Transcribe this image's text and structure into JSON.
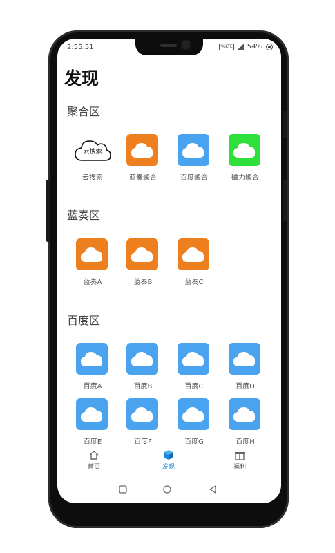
{
  "status": {
    "time": "2:55:51",
    "network_badge": "VoLTE",
    "battery": "54%"
  },
  "page": {
    "title": "发现"
  },
  "sections": [
    {
      "title": "聚合区",
      "items": [
        {
          "label": "云搜索",
          "color": "outline",
          "icon_text": "云搜索"
        },
        {
          "label": "蓝奏聚合",
          "color": "#ee7f1f"
        },
        {
          "label": "百度聚合",
          "color": "#4aa3ef"
        },
        {
          "label": "磁力聚合",
          "color": "#2fe03a"
        }
      ]
    },
    {
      "title": "蓝奏区",
      "items": [
        {
          "label": "蓝奏A",
          "color": "#ee7f1f"
        },
        {
          "label": "蓝奏B",
          "color": "#ee7f1f"
        },
        {
          "label": "蓝奏C",
          "color": "#ee7f1f"
        }
      ]
    },
    {
      "title": "百度区",
      "items": [
        {
          "label": "百度A",
          "color": "#4aa3ef"
        },
        {
          "label": "百度B",
          "color": "#4aa3ef"
        },
        {
          "label": "百度C",
          "color": "#4aa3ef"
        },
        {
          "label": "百度D",
          "color": "#4aa3ef"
        },
        {
          "label": "百度E",
          "color": "#4aa3ef"
        },
        {
          "label": "百度F",
          "color": "#4aa3ef"
        },
        {
          "label": "百度G",
          "color": "#4aa3ef"
        },
        {
          "label": "百度H",
          "color": "#4aa3ef"
        }
      ]
    }
  ],
  "tabs": [
    {
      "label": "首页",
      "icon": "home-icon",
      "active": false
    },
    {
      "label": "发现",
      "icon": "cube-icon",
      "active": true
    },
    {
      "label": "福利",
      "icon": "gift-icon",
      "active": false
    }
  ],
  "colors": {
    "accent": "#1f86d8",
    "orange": "#ee7f1f",
    "blue": "#4aa3ef",
    "green": "#2fe03a"
  },
  "system_nav": [
    "square-icon",
    "circle-icon",
    "triangle-back-icon"
  ]
}
